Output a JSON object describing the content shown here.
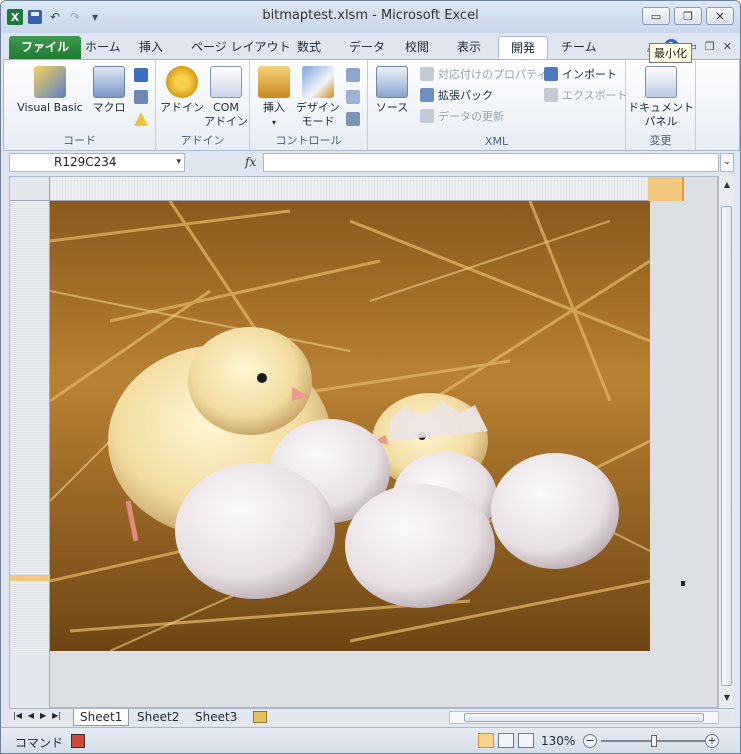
{
  "window": {
    "title": "bitmaptest.xlsm - Microsoft Excel",
    "app_icon_letter": "X",
    "controls": [
      "▭",
      "❐",
      "✕"
    ]
  },
  "quick_access": {
    "undo_glyph": "↶",
    "redo_glyph": "↷",
    "customize_glyph": "▾"
  },
  "tabs": {
    "file": "ファイル",
    "items": [
      "ホーム",
      "挿入",
      "ページ レイアウト",
      "数式",
      "データ",
      "校閲",
      "表示",
      "開発",
      "チーム"
    ],
    "active": "開発",
    "minimize_ribbon_glyph": "△",
    "help_glyph": "?",
    "tooltip": "最小化"
  },
  "ribbon": {
    "groups": {
      "code": "コード",
      "addin": "アドイン",
      "controls": "コントロール",
      "xml": "XML",
      "modify": "変更"
    },
    "visual_basic": "Visual Basic",
    "macro": "マクロ",
    "addin": "アドイン",
    "com_addin_1": "COM",
    "com_addin_2": "アドイン",
    "insert": "挿入",
    "insert_arrow": "▾",
    "design_mode_1": "デザイン",
    "design_mode_2": "モード",
    "source": "ソース",
    "map_properties": "対応付けのプロパティ",
    "expansion_packs": "拡張パック",
    "refresh_data": "データの更新",
    "import": "インポート",
    "export": "エクスポート",
    "doc_panel_1": "ドキュメント",
    "doc_panel_2": "パネル"
  },
  "formula_bar": {
    "name_box": "R129C234",
    "name_dropdown": "▾",
    "fx": "fx",
    "formula": "",
    "expand": "⌄"
  },
  "sheets": {
    "nav": [
      "|◀",
      "◀",
      "▶",
      "▶|"
    ],
    "tabs": [
      "Sheet1",
      "Sheet2",
      "Sheet3"
    ],
    "active": "Sheet1"
  },
  "status": {
    "mode": "コマンド",
    "zoom": "130%",
    "zoom_out": "−",
    "zoom_in": "+"
  },
  "picture": {
    "subject": "chicks-with-eggs-on-straw"
  }
}
